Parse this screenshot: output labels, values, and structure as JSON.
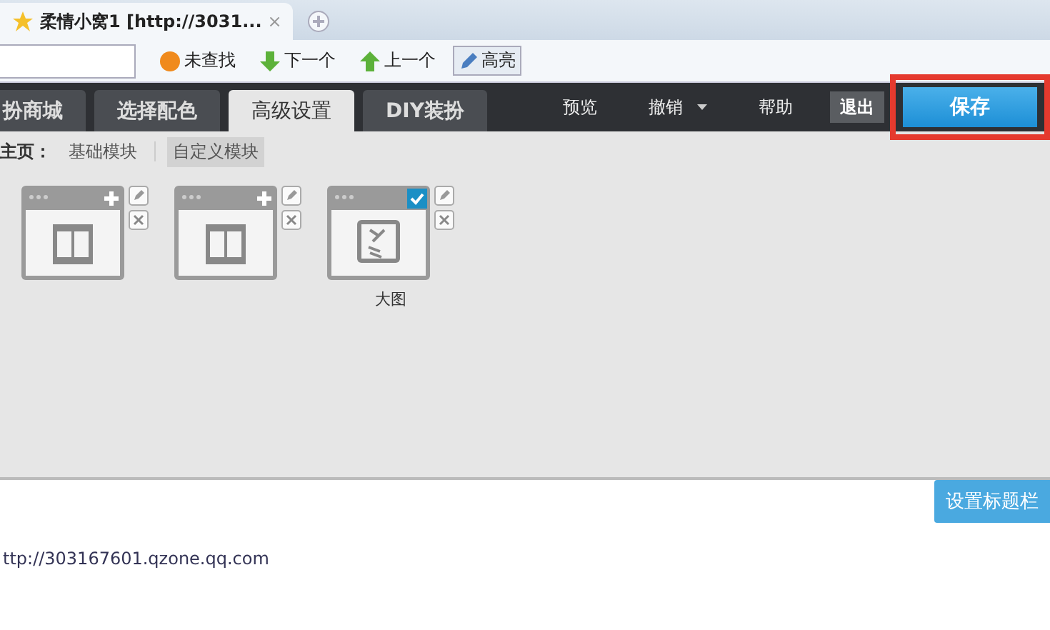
{
  "browser_tab": {
    "title": "柔情小窝1 [http://3031...",
    "close": "×"
  },
  "find_bar": {
    "buttons": [
      {
        "kind": "notfound",
        "label": "未查找"
      },
      {
        "kind": "down",
        "label": "下一个"
      },
      {
        "kind": "up",
        "label": "上一个"
      },
      {
        "kind": "highlight",
        "label": "高亮",
        "selected": true
      }
    ]
  },
  "nav_tabs": [
    {
      "label": "扮商城",
      "selected": false
    },
    {
      "label": "选择配色",
      "selected": false
    },
    {
      "label": "高级设置",
      "selected": true
    },
    {
      "label": "DIY装扮",
      "selected": false
    }
  ],
  "nav_actions": [
    {
      "label": "预览",
      "dropdown": false
    },
    {
      "label": "撤销",
      "dropdown": true
    },
    {
      "label": "帮助",
      "dropdown": false
    }
  ],
  "exit_button": "退出",
  "save_button": {
    "label": "保存",
    "highlighted": true
  },
  "breadcrumb": {
    "label": "主页：",
    "items": [
      {
        "label": "基础模块",
        "selected": false
      },
      {
        "label": "自定义模块",
        "selected": true
      }
    ]
  },
  "modules": [
    {
      "kind": "film",
      "checked": false
    },
    {
      "kind": "film",
      "checked": false
    },
    {
      "kind": "image",
      "checked": true,
      "caption": "大图"
    }
  ],
  "url": "ttp://303167601.qzone.qq.com",
  "title_bar_button": "设置标题栏"
}
